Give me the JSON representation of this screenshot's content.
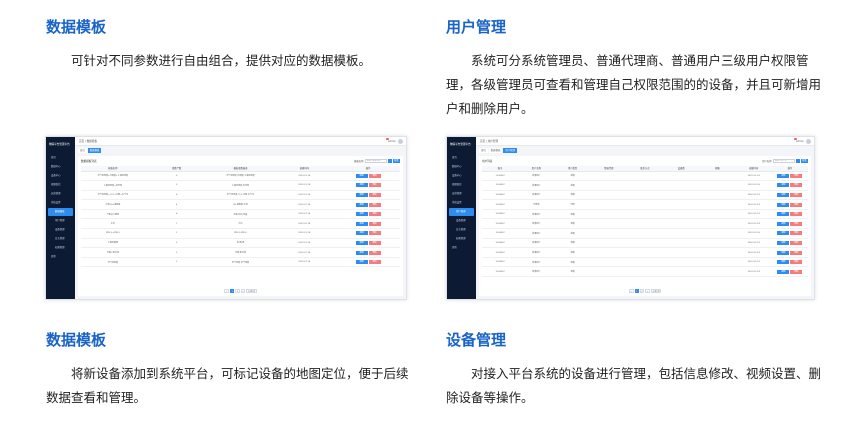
{
  "sections": [
    {
      "title": "数据模板",
      "text": "可针对不同参数进行自由组合，提供对应的数据模板。"
    },
    {
      "title": "用户管理",
      "text": "系统可分系统管理员、普通代理商、普通用户三级用户权限管理，各级管理员可查看和管理自己权限范围的的设备，并且可新增用户和删除用户。"
    },
    {
      "title": "数据模板",
      "text": "将新设备添加到系统平台，可标记设备的地图定位，便于后续数据查看和管理。"
    },
    {
      "title": "设备管理",
      "text": "对接入平台系统的设备进行管理，包括信息修改、视频设置、删除设备等操作。"
    }
  ],
  "shot1": {
    "app_title": "物联平台管理平台",
    "nav": [
      {
        "label": "首页",
        "active": false,
        "sub": false
      },
      {
        "label": "数据中心",
        "active": false,
        "sub": false
      },
      {
        "label": "设备中心",
        "active": false,
        "sub": false
      },
      {
        "label": "视频监控",
        "active": false,
        "sub": false
      },
      {
        "label": "运营管理",
        "active": false,
        "sub": false
      },
      {
        "label": "系统设置",
        "active": false,
        "sub": false
      },
      {
        "label": "数据模板",
        "active": true,
        "sub": true
      },
      {
        "label": "用户管理",
        "active": false,
        "sub": true
      },
      {
        "label": "设备管理",
        "active": false,
        "sub": true
      },
      {
        "label": "日志管理",
        "active": false,
        "sub": true
      },
      {
        "label": "权限管理",
        "active": false,
        "sub": true
      },
      {
        "label": "其他",
        "active": false,
        "sub": false
      }
    ],
    "breadcrumb": "首页 / 数据模板",
    "user": "admin",
    "tabs": [
      "首页",
      "数据模板"
    ],
    "panel_title": "数据模板列表",
    "search_label": "模板名称",
    "search_placeholder": "请输入模板名称",
    "add_label": "新增",
    "columns": [
      "模板名称",
      "参数个数",
      "模板参数描述",
      "创建时间",
      "操作"
    ],
    "rows": [
      [
        "空气温湿度+光照度+土壤温湿度",
        "5",
        "空气温湿度,光照度,土壤温湿度",
        "2022-01-14",
        ""
      ],
      [
        "土壤温湿度+电导率",
        "3",
        "土壤温湿度,电导率",
        "2022-01-14",
        ""
      ],
      [
        "空气温湿度+CO2+光照+大气压",
        "6",
        "空气温湿度,CO2,光照,大气压",
        "2022-01-14",
        ""
      ],
      [
        "水质PH+溶解氧",
        "4",
        "PH,溶解氧,水温",
        "2022-01-14",
        ""
      ],
      [
        "气象站六要素",
        "6",
        "风速,风向,雨量",
        "2022-01-14",
        ""
      ],
      [
        "水位",
        "1",
        "水位",
        "2022-01-14",
        ""
      ],
      [
        "PM2.5+PM10",
        "2",
        "PM2.5,PM10",
        "2022-01-14",
        ""
      ],
      [
        "土壤氮磷钾",
        "3",
        "氮,磷,钾",
        "2022-01-14",
        ""
      ],
      [
        "光照+紫外线",
        "2",
        "光照,紫外线",
        "2022-01-14",
        ""
      ],
      [
        "空气温湿度",
        "2",
        "空气温度,空气湿度",
        "2022-01-14",
        ""
      ]
    ],
    "edit_label": "编辑",
    "delete_label": "删除",
    "pager": [
      "<",
      "1",
      "2",
      ">",
      "10条/页"
    ]
  },
  "shot2": {
    "app_title": "物联平台管理平台",
    "nav": [
      {
        "label": "首页",
        "active": false,
        "sub": false
      },
      {
        "label": "数据中心",
        "active": false,
        "sub": false
      },
      {
        "label": "设备中心",
        "active": false,
        "sub": false
      },
      {
        "label": "视频监控",
        "active": false,
        "sub": false
      },
      {
        "label": "运营管理",
        "active": false,
        "sub": false
      },
      {
        "label": "系统设置",
        "active": false,
        "sub": false
      },
      {
        "label": "用户管理",
        "active": true,
        "sub": true
      },
      {
        "label": "设备管理",
        "active": false,
        "sub": true
      },
      {
        "label": "日志管理",
        "active": false,
        "sub": true
      },
      {
        "label": "权限管理",
        "active": false,
        "sub": true
      },
      {
        "label": "其他",
        "active": false,
        "sub": false
      }
    ],
    "breadcrumb": "首页 / 用户管理",
    "user": "admin",
    "tabs": [
      "首页",
      "数据模板",
      "用户管理"
    ],
    "panel_title": "用户列表",
    "search_label": "用户名称",
    "search_placeholder": "请输入用户名",
    "add_label": "新增",
    "columns": [
      "账号",
      "用户名称",
      "用户类型",
      "所属代理",
      "联系方式",
      "设备数",
      "邮箱",
      "创建时间",
      "操作"
    ],
    "rows": [
      [
        "1234567",
        "普通用户",
        "普通",
        "",
        "",
        "",
        "",
        "2022-01-14",
        ""
      ],
      [
        "1234567",
        "普通用户",
        "普通",
        "",
        "",
        "",
        "",
        "2022-01-14",
        ""
      ],
      [
        "1234567",
        "普通用户",
        "普通",
        "",
        "",
        "",
        "",
        "2022-01-14",
        ""
      ],
      [
        "1234567",
        "代理商",
        "代理",
        "",
        "",
        "",
        "",
        "2022-01-14",
        ""
      ],
      [
        "1234567",
        "普通用户",
        "普通",
        "",
        "",
        "",
        "",
        "2022-01-14",
        ""
      ],
      [
        "1234567",
        "普通用户",
        "普通",
        "",
        "",
        "",
        "",
        "2022-01-14",
        ""
      ],
      [
        "1234567",
        "普通用户",
        "普通",
        "",
        "",
        "",
        "",
        "2022-01-14",
        ""
      ],
      [
        "1234567",
        "普通用户",
        "普通",
        "",
        "",
        "",
        "",
        "2022-01-14",
        ""
      ],
      [
        "1234567",
        "普通用户",
        "普通",
        "",
        "",
        "",
        "",
        "2022-01-14",
        ""
      ],
      [
        "1234567",
        "普通用户",
        "普通",
        "",
        "",
        "",
        "",
        "2022-01-14",
        ""
      ],
      [
        "1234567",
        "普通用户",
        "普通",
        "",
        "",
        "",
        "",
        "2022-01-14",
        ""
      ]
    ],
    "edit_label": "编辑",
    "delete_label": "删除",
    "pager": [
      "<",
      "1",
      "2",
      ">",
      "10条/页"
    ]
  }
}
